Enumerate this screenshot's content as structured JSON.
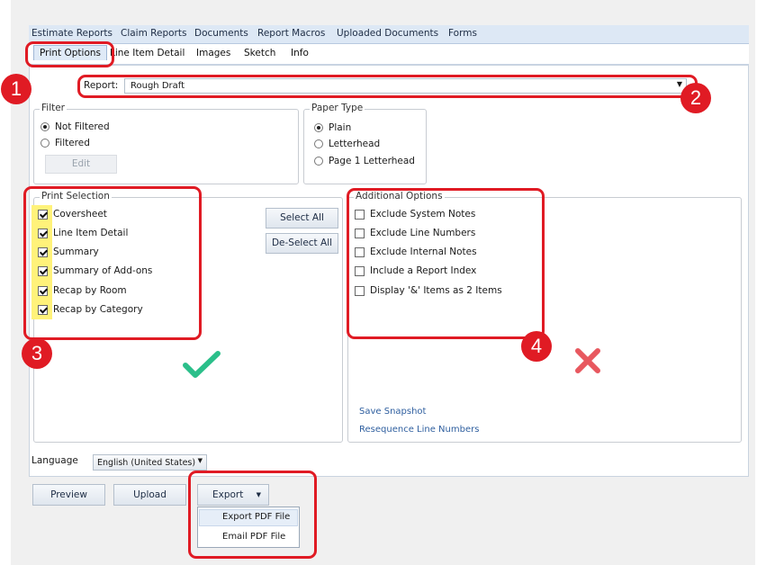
{
  "top_tabs": [
    "Estimate Reports",
    "Claim Reports",
    "Documents",
    "Report Macros",
    "Uploaded Documents",
    "Forms"
  ],
  "sub_tabs": [
    "Print Options",
    "Line Item Detail",
    "Images",
    "Sketch",
    "Info"
  ],
  "report": {
    "label": "Report:",
    "value": "Rough Draft"
  },
  "filter": {
    "title": "Filter",
    "options": [
      "Not Filtered",
      "Filtered"
    ],
    "selected": 0,
    "edit_label": "Edit"
  },
  "paper_type": {
    "title": "Paper Type",
    "options": [
      "Plain",
      "Letterhead",
      "Page 1 Letterhead"
    ],
    "selected": 0
  },
  "print_selection": {
    "title": "Print Selection",
    "items": [
      "Coversheet",
      "Line Item Detail",
      "Summary",
      "Summary of Add-ons",
      "Recap by Room",
      "Recap by Category"
    ],
    "select_all": "Select All",
    "deselect_all": "De-Select All"
  },
  "additional_options": {
    "title": "Additional Options",
    "items": [
      "Exclude System Notes",
      "Exclude Line Numbers",
      "Exclude Internal Notes",
      "Include a Report Index",
      "Display '&' Items as 2 Items"
    ]
  },
  "links": {
    "save_snapshot": "Save Snapshot",
    "resequence": "Resequence Line Numbers"
  },
  "language": {
    "label": "Language",
    "value": "English (United States)"
  },
  "buttons": {
    "preview": "Preview",
    "upload": "Upload",
    "export": "Export"
  },
  "export_menu": [
    "Export PDF File",
    "Email PDF File"
  ],
  "callouts": [
    "1",
    "2",
    "3",
    "4"
  ],
  "colors": {
    "callout": "#e01b24",
    "highlight": "#fff27a",
    "check": "#2bbf8a",
    "cross": "#e8585f"
  }
}
